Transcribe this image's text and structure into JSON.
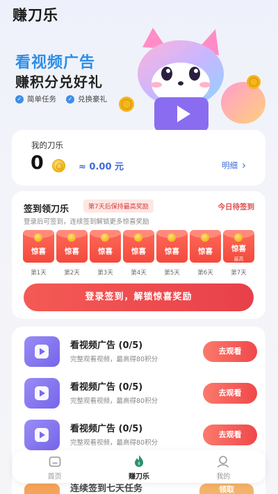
{
  "app": {
    "title": "赚刀乐"
  },
  "hero": {
    "line1": "看视频广告",
    "line2": "赚积分兑好礼",
    "tags": [
      "简单任务",
      "兑换豪礼"
    ]
  },
  "balance": {
    "label": "我的刀乐",
    "amount": "0",
    "rmb": "≈ 0.00 元",
    "detail_label": "明细",
    "detail_chevron": "›"
  },
  "signin": {
    "title": "签到领刀乐",
    "badge": "第7天后保持最高奖励",
    "status": "今日待签到",
    "hint": "登录后可签到，连续签到解锁更多惊喜奖励",
    "days": [
      {
        "reward": "惊喜",
        "label": "第1天"
      },
      {
        "reward": "惊喜",
        "label": "第2天"
      },
      {
        "reward": "惊喜",
        "label": "第3天"
      },
      {
        "reward": "惊喜",
        "label": "第4天"
      },
      {
        "reward": "惊喜",
        "label": "第5天"
      },
      {
        "reward": "惊喜",
        "label": "第6天"
      },
      {
        "reward": "惊喜",
        "sub": "最高",
        "label": "第7天"
      }
    ],
    "button_label": "登录签到，解锁惊喜奖励"
  },
  "tasks": [
    {
      "title": "看视频广告 (0/5)",
      "desc": "完整观看视频，最高得80积分",
      "button": "去观看"
    },
    {
      "title": "看视频广告 (0/5)",
      "desc": "完整观看视频，最高得80积分",
      "button": "去观看"
    },
    {
      "title": "看视频广告 (0/5)",
      "desc": "完整观看视频，最高得80积分",
      "button": "去观看"
    }
  ],
  "partial_task": {
    "title": "连续签到七天任务",
    "button": "领取"
  },
  "tabbar": {
    "items": [
      {
        "label": "首页",
        "icon": "home-icon",
        "active": false
      },
      {
        "label": "赚刀乐",
        "icon": "flame-icon",
        "active": true
      },
      {
        "label": "我的",
        "icon": "profile-icon",
        "active": false
      }
    ]
  },
  "colors": {
    "accent_blue": "#2b8de8",
    "accent_red": "#f0484a",
    "task_purple": "#7565ea"
  }
}
